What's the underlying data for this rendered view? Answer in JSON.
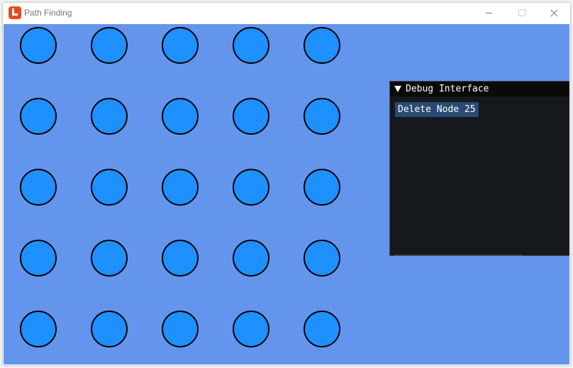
{
  "window": {
    "title": "Path Finding",
    "icon": "monogame-icon"
  },
  "titlebar_buttons": [
    "minimize-icon",
    "maximize-icon",
    "close-icon"
  ],
  "canvas": {
    "background_color": "#6495ed",
    "node_fill": "#1e90ff",
    "node_stroke": "#000000",
    "grid_rows": 5,
    "grid_cols": 5,
    "node_count": 25
  },
  "debug_interface": {
    "title": "Debug Interface",
    "collapse_icon": "triangle-down-icon",
    "delete_button_label": "Delete Node 25",
    "background_color": "#15181d",
    "button_color": "#2a4a75"
  }
}
